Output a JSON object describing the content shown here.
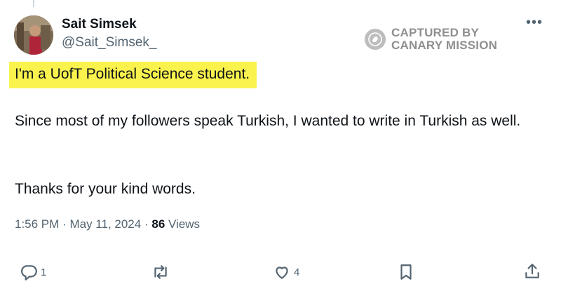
{
  "author": {
    "display_name": "Sait Simsek",
    "handle": "@Sait_Simsek_"
  },
  "watermark": {
    "line1": "CAPTURED BY",
    "line2": "CANARY MISSION"
  },
  "more_label": "•••",
  "tweet": {
    "highlighted_text": "I'm a UofT Political Science student.",
    "paragraphs": [
      "Since most of my followers speak Turkish, I wanted to write in Turkish as well.",
      "Thanks for your kind words."
    ],
    "time": "1:56 PM",
    "sep1": "·",
    "date": "May 11, 2024",
    "sep2": "·",
    "views_count": "86",
    "views_label": "Views"
  },
  "actions": {
    "reply_count": "1",
    "like_count": "4"
  },
  "colors": {
    "highlight": "#fbf34d",
    "secondary_text": "#536471",
    "primary_text": "#0f1419"
  },
  "icons": [
    "reply-icon",
    "retweet-icon",
    "like-icon",
    "bookmark-icon",
    "share-icon",
    "canary-mission-icon"
  ]
}
